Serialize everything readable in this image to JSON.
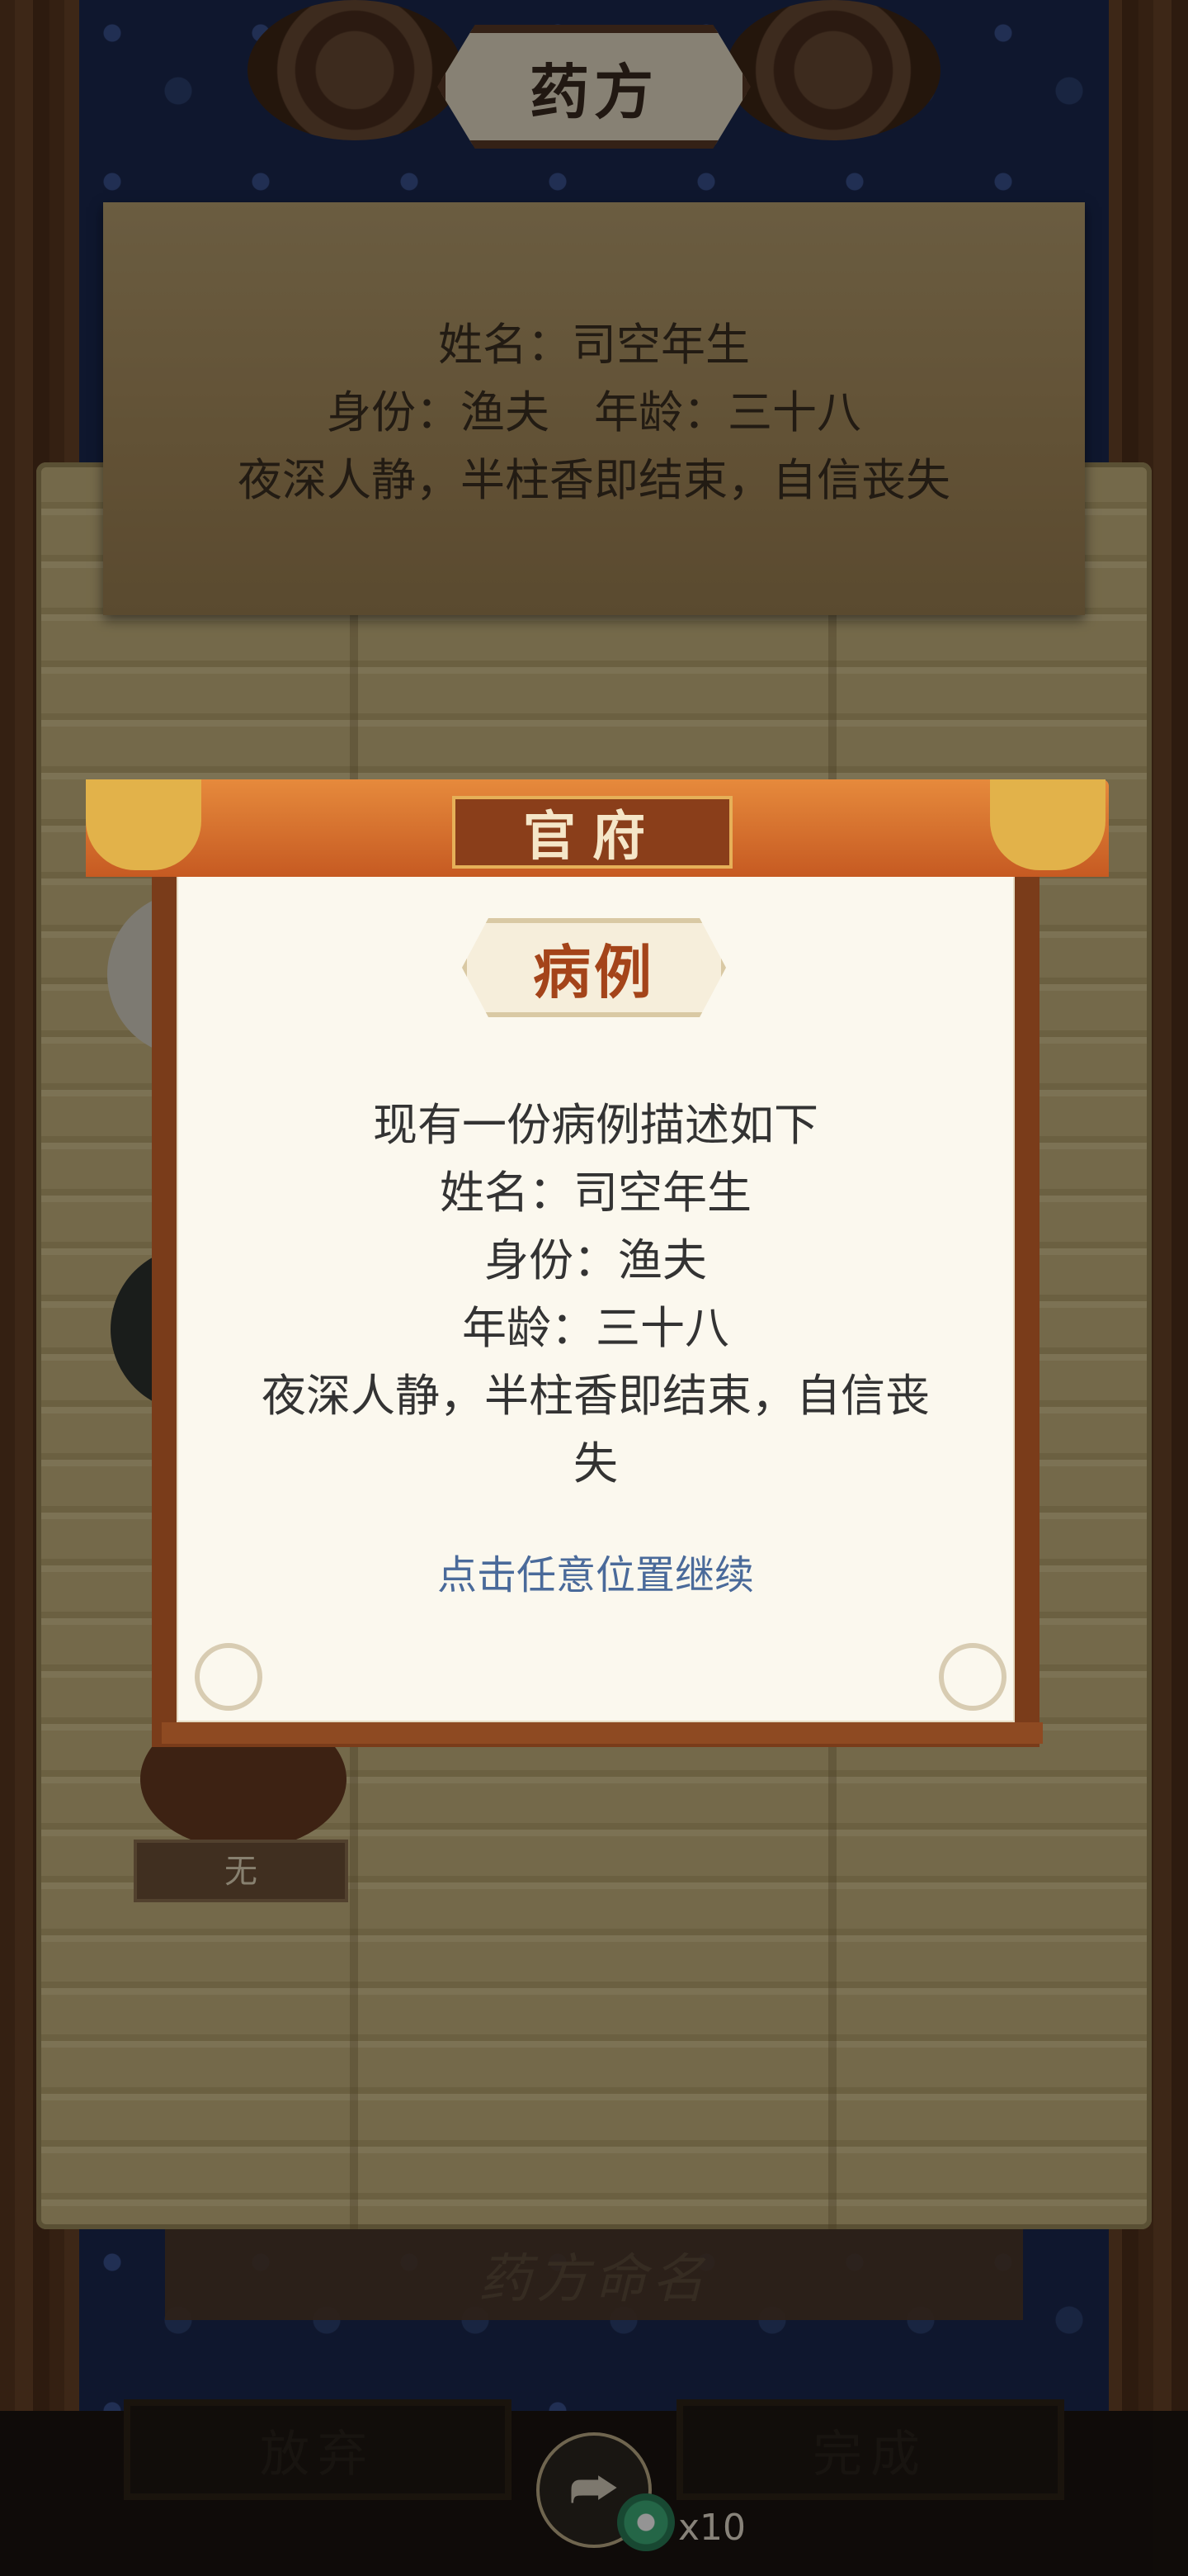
{
  "header": {
    "title": "药方"
  },
  "patient_card": {
    "name_line": "姓名：司空年生",
    "identity_age_line": "身份：渔夫　年龄：三十八",
    "symptom_line": "夜深人静，半柱香即结束，自信丧失"
  },
  "ingredient_slots": {
    "empty_label": "无"
  },
  "recipe_name_placeholder": "药方命名",
  "bottom_bar": {
    "abandon_label": "放弃",
    "finish_label": "完成",
    "count_label": "x10"
  },
  "dialog": {
    "header_title": "官府",
    "badge": "病例",
    "lines": [
      "现有一份病例描述如下",
      "姓名：司空年生",
      "身份：渔夫",
      "年龄：三十八",
      "夜深人静，半柱香即结束，自信丧",
      "失"
    ],
    "hint": "点击任意位置继续"
  },
  "icons": {
    "share": "share-icon",
    "jade": "jade-coin-icon"
  },
  "colors": {
    "dialog_header": "#d6702c",
    "dialog_frame": "#7a3c1a",
    "hint": "#4a6a9a"
  }
}
